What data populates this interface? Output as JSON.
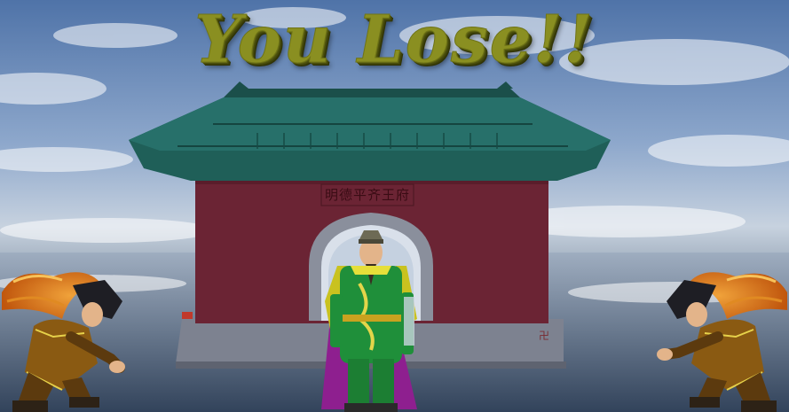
{
  "game": {
    "result_text": "You Lose!!"
  },
  "gate": {
    "plaque_text": "明德平齐王府"
  },
  "colors": {
    "title": "#8a8f21",
    "roof": "#1f5f58",
    "wall": "#6b2434",
    "base": "#7d8290",
    "robe": "#1f8f3a",
    "cape": "#8e1f8f"
  }
}
